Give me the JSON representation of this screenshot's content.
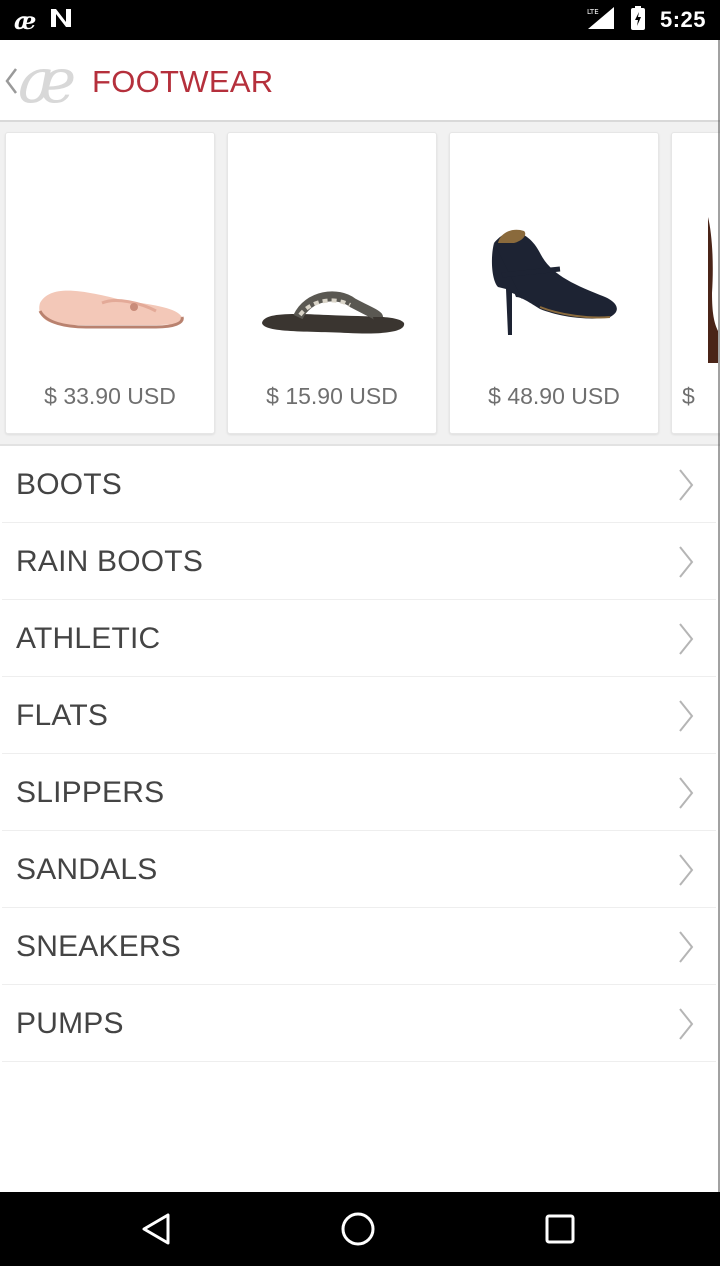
{
  "status_bar": {
    "time": "5:25",
    "app_icon_glyph": "æ",
    "left_icons": [
      "app-notification-icon",
      "n-notification-icon"
    ],
    "right_icons": [
      "signal-icon",
      "battery-icon"
    ]
  },
  "app_bar": {
    "title": "FOOTWEAR",
    "title_color": "#b5303c",
    "back_icon": "chevron-left-icon",
    "logo_icon": "brand-logo-icon"
  },
  "products": [
    {
      "price": "$ 33.90 USD",
      "image": "ballet-flat-shoe"
    },
    {
      "price": "$ 15.90 USD",
      "image": "flip-flop-sandal"
    },
    {
      "price": "$ 48.90 USD",
      "image": "mary-jane-pump"
    },
    {
      "price": "$",
      "image": "boot"
    }
  ],
  "categories": [
    {
      "label": "BOOTS"
    },
    {
      "label": "RAIN BOOTS"
    },
    {
      "label": "ATHLETIC"
    },
    {
      "label": "FLATS"
    },
    {
      "label": "SLIPPERS"
    },
    {
      "label": "SANDALS"
    },
    {
      "label": "SNEAKERS"
    },
    {
      "label": "PUMPS"
    }
  ],
  "nav_bar": {
    "buttons": [
      "back-triangle-icon",
      "home-circle-icon",
      "recents-square-icon"
    ]
  }
}
